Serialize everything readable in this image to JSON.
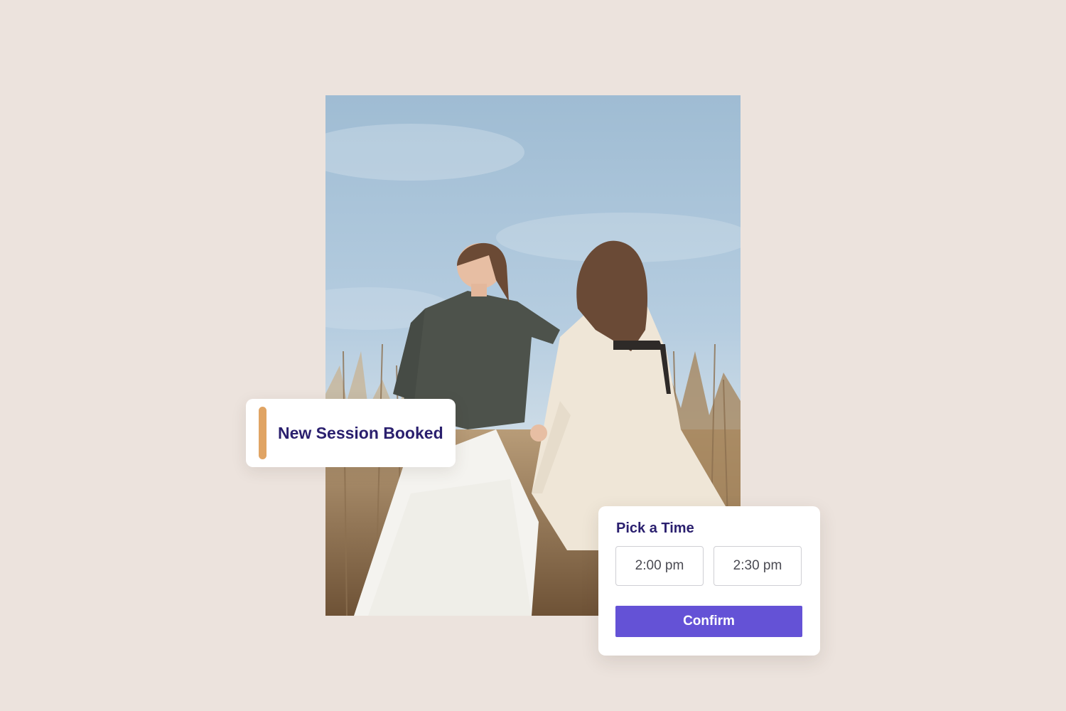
{
  "notification": {
    "title": "New Session Booked",
    "accent_color": "#e0a464"
  },
  "time_picker": {
    "heading": "Pick a Time",
    "slots": [
      {
        "label": "2:00 pm"
      },
      {
        "label": "2:30 pm"
      }
    ],
    "confirm_label": "Confirm",
    "accent_color": "#6452d6"
  },
  "colors": {
    "background": "#ece3dd",
    "heading_text": "#2a1f6e"
  }
}
